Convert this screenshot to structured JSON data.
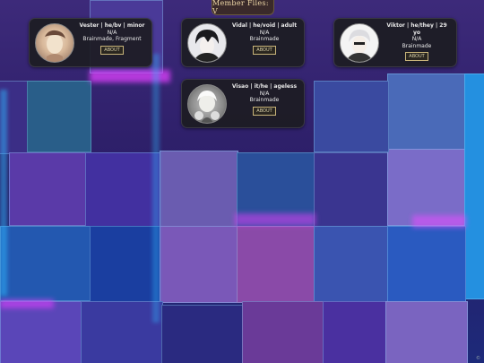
{
  "header": {
    "title": "Member Files: V"
  },
  "members": [
    {
      "name": "Vester | he/bv | minor",
      "status": "N/A",
      "origin": "Brainmade, Fragment",
      "about_label": "ABOUT",
      "avatar_icon": "portrait-cat-avatar"
    },
    {
      "name": "Vidal | he/void | adult",
      "status": "N/A",
      "origin": "Brainmade",
      "about_label": "ABOUT",
      "avatar_icon": "portrait-dark-hair-avatar"
    },
    {
      "name": "Viktor | he/they | 29 yo",
      "status": "N/A",
      "origin": "Brainmade",
      "about_label": "ABOUT",
      "avatar_icon": "portrait-white-hair-avatar"
    },
    {
      "name": "Visao | it/he | ageless",
      "status": "N/A",
      "origin": "Brainmade",
      "about_label": "ABOUT",
      "avatar_icon": "portrait-skull-avatar"
    }
  ],
  "footer": {
    "corner_mark": "©"
  },
  "colors": {
    "card_bg": "#1c1c22",
    "accent": "#f0d9a8",
    "magenta": "#e040ff",
    "cyan": "#2fb8ff"
  }
}
